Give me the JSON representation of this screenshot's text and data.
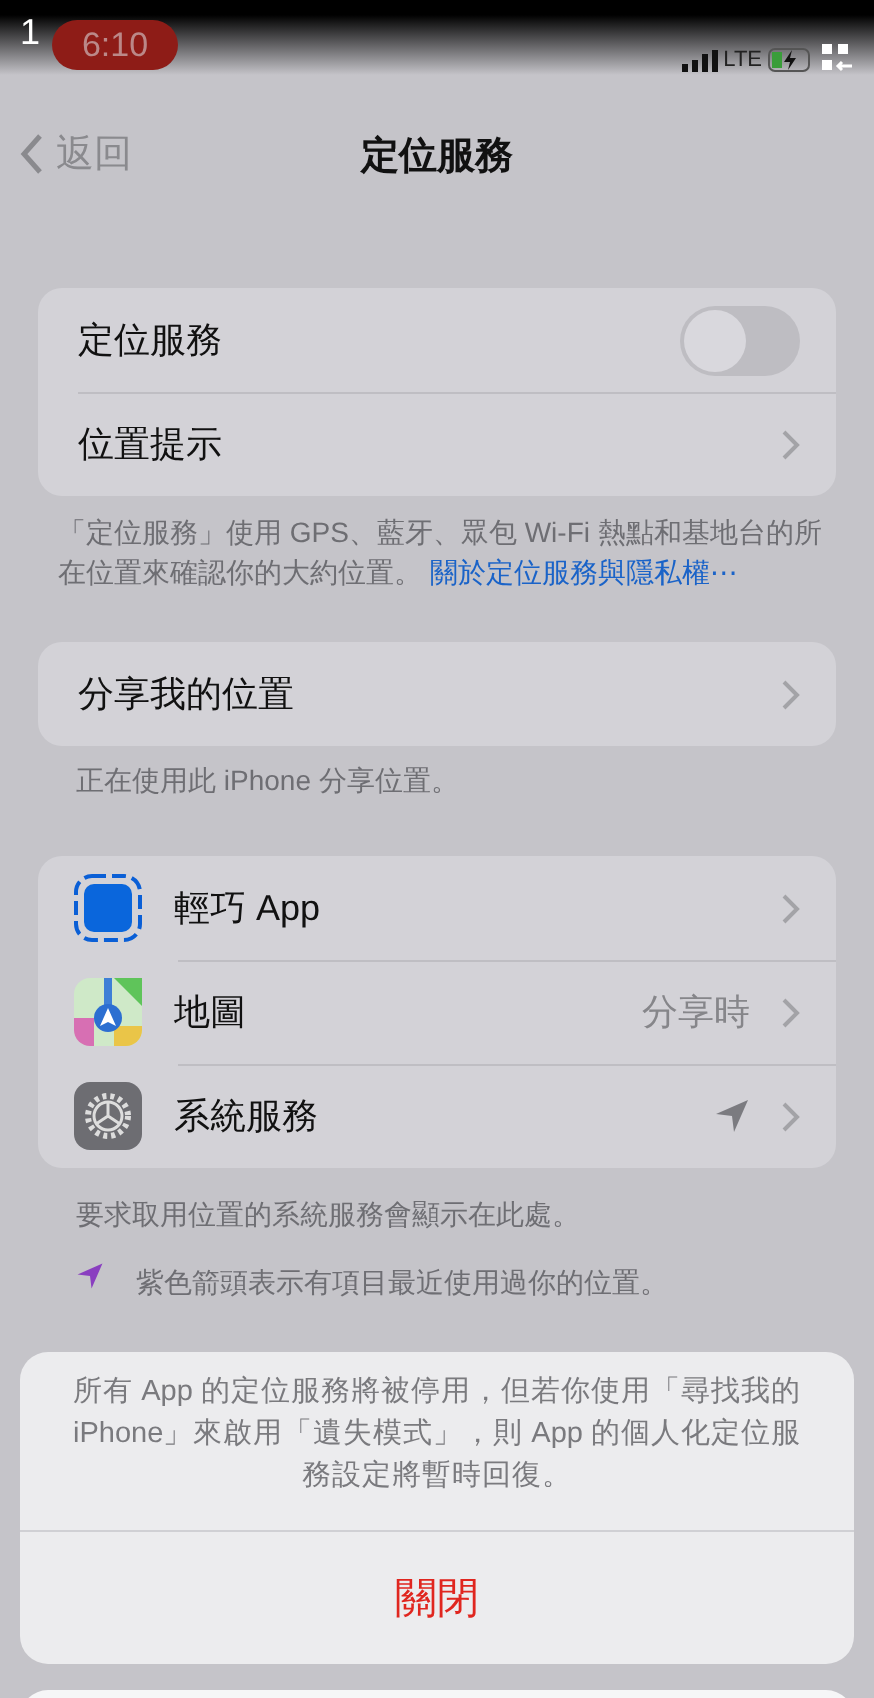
{
  "overlay_badge": "1",
  "status_bar": {
    "time": "6:10",
    "network": "LTE",
    "charging": true
  },
  "nav": {
    "back": "返回",
    "title": "定位服務"
  },
  "main_group": [
    {
      "kind": "toggle",
      "label": "定位服務",
      "on": false
    },
    {
      "kind": "link",
      "label": "位置提示"
    }
  ],
  "main_footer": {
    "text": "「定位服務」使用 GPS、藍牙、眾包 Wi-Fi 熱點和基地台的所在位置來確認你的大約位置。",
    "link": "關於定位服務與隱私權⋯"
  },
  "share_group": [
    {
      "kind": "link",
      "label": "分享我的位置"
    }
  ],
  "share_footer": "正在使用此 iPhone 分享位置。",
  "apps": [
    {
      "label": "輕巧 App"
    },
    {
      "label": "地圖",
      "value": "分享時"
    },
    {
      "label": "系統服務",
      "arrow": true
    }
  ],
  "apps_footer": "要求取用位置的系統服務會顯示在此處。",
  "legend": "紫色箭頭表示有項目最近使用過你的位置。",
  "sheet": {
    "message": "所有 App 的定位服務將被停用，但若你使用「尋找我的 iPhone」來啟用「遺失模式」，則 App 的個人化定位服務設定將暫時回復。",
    "action": "關閉"
  }
}
